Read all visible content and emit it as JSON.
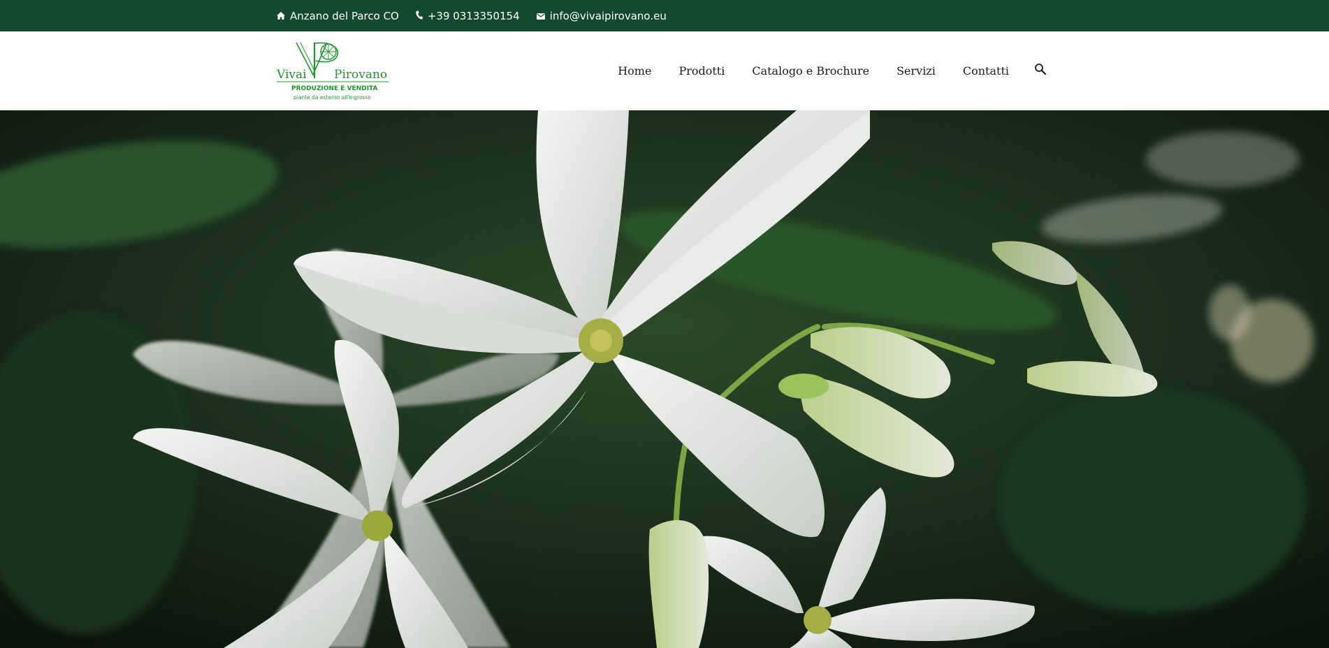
{
  "topbar": {
    "location_text": "Anzano del Parco CO",
    "phone_text": "+39 0313350154",
    "email_text": "info@vivaipirovano.eu",
    "location_icon": "home-icon",
    "phone_icon": "phone-icon",
    "email_icon": "envelope-icon"
  },
  "logo": {
    "brand_left": "Vivai",
    "brand_right": "Pirovano",
    "tagline": "PRODUZIONE E VENDITA",
    "subtagline": "piante da esterno all'ingrosso"
  },
  "nav": {
    "items": [
      "Home",
      "Prodotti",
      "Catalogo e Brochure",
      "Servizi",
      "Contatti"
    ],
    "search_icon": "search-icon"
  },
  "colors": {
    "topbar_bg": "#134a2f",
    "brand_green": "#1a9a2a",
    "nav_text": "#1c1c1c"
  }
}
